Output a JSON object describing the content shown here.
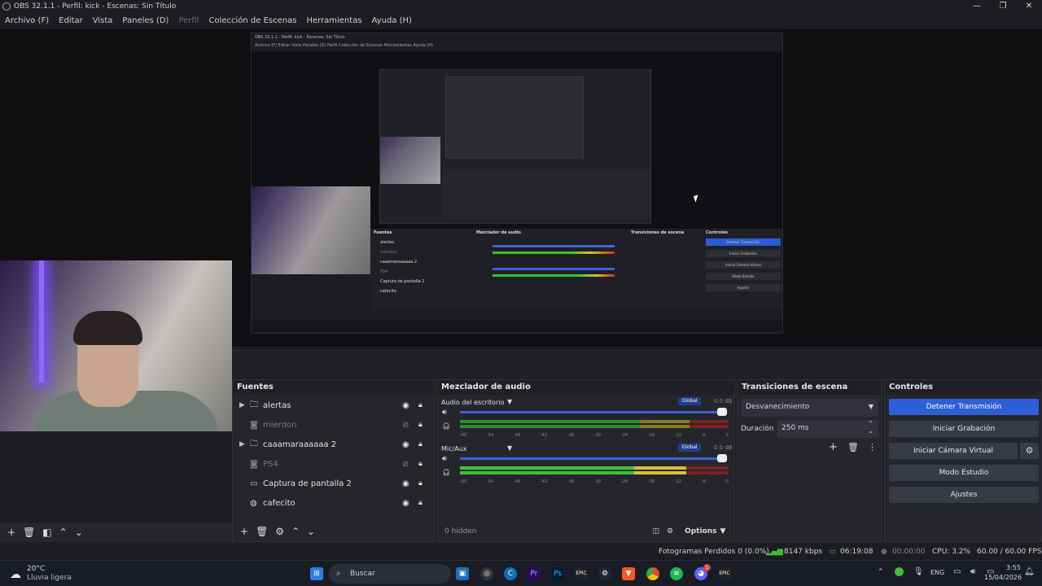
{
  "window": {
    "title": "OBS 32.1.1 - Perfil: kick - Escenas: Sin Título",
    "minimize": "—",
    "maximize": "❐",
    "close": "✕"
  },
  "menu": [
    "Archivo (F)",
    "Editar",
    "Vista",
    "Paneles (D)",
    "Perfil",
    "Colección de Escenas",
    "Herramientas",
    "Ayuda (H)"
  ],
  "nested_preview": {
    "title": "OBS 32.1.1 - Perfil: kick - Escenas: Sin Título",
    "menu": "Archivo (F)   Editar   Vista   Paneles (D)   Perfil   Colección de Escenas   Herramientas   Ayuda (H)",
    "panels": [
      "Fuentes",
      "Mezclador de audio",
      "Transiciones de escena",
      "Controles"
    ],
    "buttons": [
      "Detener Transmisión",
      "Iniciar Grabación",
      "Iniciar Cámara Virtual",
      "Modo Estudio",
      "Ajustes"
    ],
    "sources": [
      "alertas",
      "mierdon",
      "caaamaraaaaaa 2",
      "PS4",
      "Captura de pantalla 2",
      "cafecito"
    ]
  },
  "sources": {
    "title": "Fuentes",
    "items": [
      {
        "label": "alertas",
        "icon": "folder-icon",
        "group": true,
        "dim": false
      },
      {
        "label": "mierdon",
        "icon": "camera-icon",
        "group": false,
        "dim": true
      },
      {
        "label": "caaamaraaaaaa 2",
        "icon": "folder-icon",
        "group": true,
        "dim": false
      },
      {
        "label": "PS4",
        "icon": "camera-icon",
        "group": false,
        "dim": true
      },
      {
        "label": "Captura de pantalla 2",
        "icon": "monitor-icon",
        "group": false,
        "dim": false
      },
      {
        "label": "cafecito",
        "icon": "browser-icon",
        "group": false,
        "dim": false
      }
    ]
  },
  "mixer": {
    "title": "Mezclador de audio",
    "tracks": [
      {
        "name": "Audio del escritorio",
        "global": "Global",
        "db": "0.0 dB"
      },
      {
        "name": "Mic/Aux",
        "global": "Global",
        "db": "0.0 dB"
      }
    ],
    "ticks": [
      "-60",
      "-54",
      "-48",
      "-42",
      "-36",
      "-30",
      "-24",
      "-18",
      "-12",
      "-6",
      "0"
    ],
    "hidden": "0 hidden",
    "options": "Options"
  },
  "transitions": {
    "title": "Transiciones de escena",
    "selected": "Desvanecimiento",
    "duration_label": "Duración",
    "duration_value": "250 ms"
  },
  "controls": {
    "title": "Controles",
    "stop_stream": "Detener Transmisión",
    "start_record": "Iniciar Grabación",
    "virtual_cam": "Iniciar Cámara Virtual",
    "studio_mode": "Modo Estudio",
    "settings": "Ajustes"
  },
  "status": {
    "dropped": "Fotogramas Perdidos 0 (0.0%)",
    "bitrate": "8147 kbps",
    "stream_time": "06:19:08",
    "rec_time": "00:00:00",
    "cpu": "CPU: 3.2%",
    "fps": "60.00 / 60.00 FPS"
  },
  "taskbar": {
    "weather_temp": "20°C",
    "weather_desc": "Lluvia ligera",
    "search": "Buscar",
    "lang": "ENG",
    "time": "3:55",
    "date": "15/04/2026",
    "apps": [
      "Pr",
      "Ps",
      "EPIC",
      "EPIC"
    ],
    "chat_badge": "1"
  },
  "colors": {
    "accent": "#2f5ed9",
    "meter_green": "#3bbf3b",
    "meter_yellow": "#d9c030",
    "meter_red": "#c9302c"
  }
}
